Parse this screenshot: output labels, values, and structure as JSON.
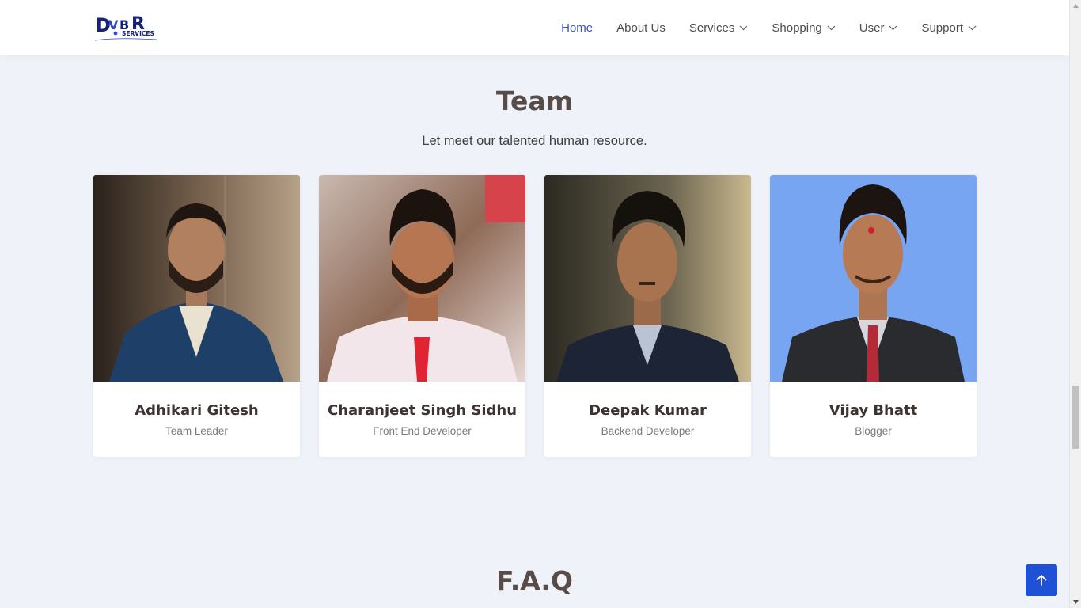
{
  "header": {
    "logo_text": "DVBR",
    "logo_sub": "SERVICES",
    "nav": [
      {
        "label": "Home",
        "active": true,
        "dropdown": false
      },
      {
        "label": "About Us",
        "active": false,
        "dropdown": false
      },
      {
        "label": "Services",
        "active": false,
        "dropdown": true
      },
      {
        "label": "Shopping",
        "active": false,
        "dropdown": true
      },
      {
        "label": "User",
        "active": false,
        "dropdown": true
      },
      {
        "label": "Support",
        "active": false,
        "dropdown": true
      }
    ]
  },
  "team": {
    "title": "Team",
    "subtitle": "Let meet our talented human resource.",
    "members": [
      {
        "name": "Adhikari Gitesh",
        "role": "Team Leader"
      },
      {
        "name": "Charanjeet Singh Sidhu",
        "role": "Front End Developer"
      },
      {
        "name": "Deepak Kumar",
        "role": "Backend Developer"
      },
      {
        "name": "Vijay Bhatt",
        "role": "Blogger"
      }
    ]
  },
  "faq": {
    "title": "F.A.Q"
  },
  "colors": {
    "accent": "#3b55c9",
    "back_to_top": "#1f51d6",
    "page_bg": "#f0f2f9",
    "heading": "#574c48"
  },
  "icons": {
    "back_to_top": "arrow-up-icon",
    "dropdown": "chevron-down-icon"
  }
}
